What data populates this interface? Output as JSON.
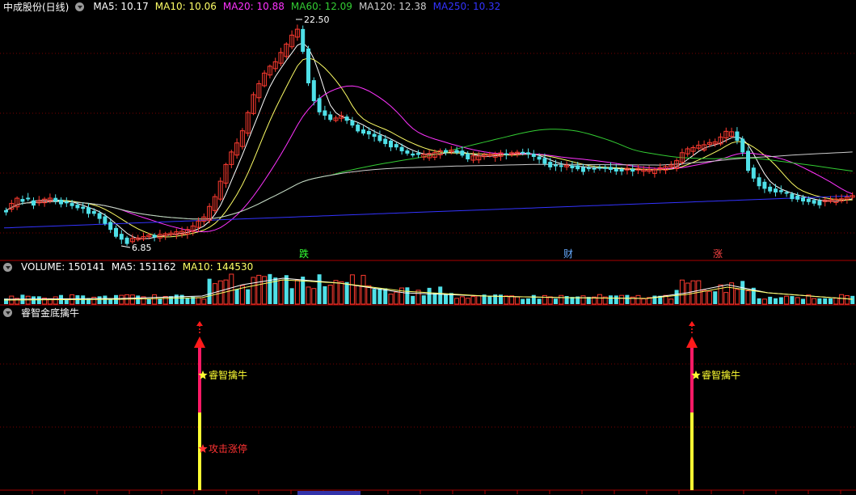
{
  "colors": {
    "bg": "#000000",
    "up": "#ff3b30",
    "down": "#4fe0e8",
    "grid": "#7a0000",
    "ma5": "#ffffff",
    "ma10": "#ffff66",
    "ma20": "#ff33ff",
    "ma60": "#33cc33",
    "ma120": "#cccccc",
    "ma250": "#3333ff",
    "label_fall": "#33ff33",
    "label_cai": "#66aaff",
    "label_rise": "#ff4444"
  },
  "main": {
    "title": "中成股份(日线)",
    "ma_labels": [
      {
        "text": "MA5: 10.17",
        "color": "#ffffff"
      },
      {
        "text": "MA10: 10.06",
        "color": "#ffff66"
      },
      {
        "text": "MA20: 10.88",
        "color": "#ff33ff"
      },
      {
        "text": "MA60: 12.09",
        "color": "#33cc33"
      },
      {
        "text": "MA120: 12.38",
        "color": "#cccccc"
      },
      {
        "text": "MA250: 10.32",
        "color": "#3333ff"
      }
    ],
    "high_label": "22.50",
    "low_label": "6.85",
    "markers": [
      "跌",
      "财",
      "涨"
    ]
  },
  "volume": {
    "labels": [
      {
        "text": "VOLUME: 150141",
        "color": "#ffffff"
      },
      {
        "text": "MA5: 151162",
        "color": "#ffffff"
      },
      {
        "text": "MA10: 144530",
        "color": "#ffff66"
      }
    ]
  },
  "indicator": {
    "title": "睿智金底擒牛",
    "signals": [
      {
        "top_label": "睿智擒牛",
        "bottom_label": "攻击涨停"
      },
      {
        "top_label": "睿智擒牛",
        "bottom_label": ""
      }
    ]
  }
}
